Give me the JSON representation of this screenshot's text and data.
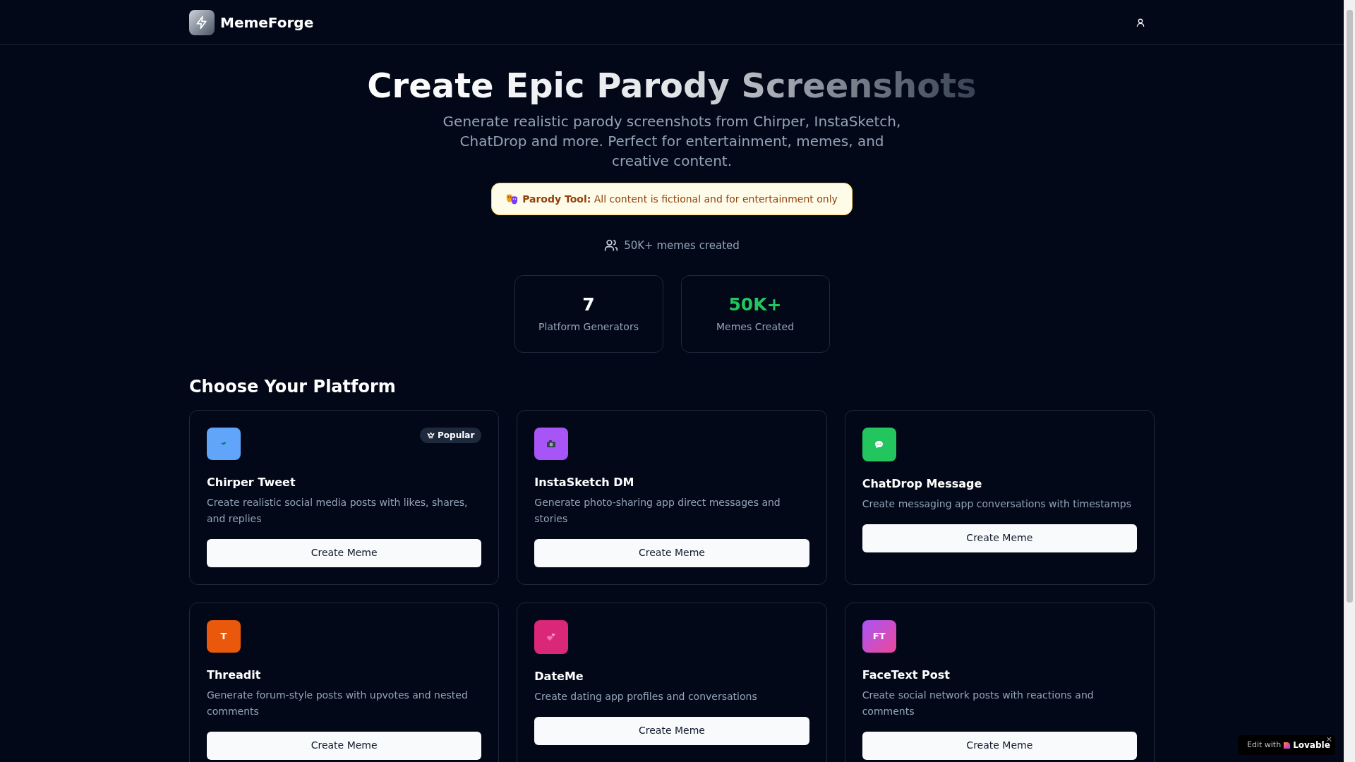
{
  "header": {
    "brand": "MemeForge"
  },
  "hero": {
    "title": "Create Epic Parody Screenshots",
    "subtitle": "Generate realistic parody screenshots from Chirper, InstaSketch, ChatDrop and more. Perfect for entertainment, memes, and creative content.",
    "notice": "**Parody Tool:** All content is fictional and for entertainment only",
    "count": "50K+ memes created"
  },
  "stats": [
    {
      "value": "7",
      "label": "Platform Generators",
      "color": "#ffffff"
    },
    {
      "value": "50K+",
      "label": "Memes Created",
      "color": "#22c55e"
    }
  ],
  "section_title": "Choose Your Platform",
  "platforms": [
    {
      "name": "Chirper Tweet",
      "description": "Create realistic social media posts with likes, shares, and replies",
      "kind": "bird",
      "color": "#60a5fa",
      "badge": "Popular",
      "button": "Create Meme"
    },
    {
      "name": "InstaSketch DM",
      "description": "Generate photo-sharing app direct messages and stories",
      "kind": "camera",
      "color": "#a855f7",
      "button": "Create Meme"
    },
    {
      "name": "ChatDrop Message",
      "description": "Create messaging app conversations with timestamps",
      "kind": "chat",
      "color": "#22c55e",
      "button": "Create Meme"
    },
    {
      "name": "Threadit",
      "description": "Generate forum-style posts with upvotes and nested comments",
      "kind": "letters",
      "letters": "T",
      "color": "#ea580c",
      "button": "Create Meme"
    },
    {
      "name": "DateMe",
      "description": "Create dating app profiles and conversations",
      "kind": "hearts",
      "color": "#db2777",
      "button": "Create Meme"
    },
    {
      "name": "FaceText Post",
      "description": "Create social network posts with reactions and comments",
      "kind": "letters",
      "letters": "FT",
      "color": "#c04be0",
      "button": "Create Meme"
    }
  ],
  "overlay_badge": {
    "prefix": "Edit with",
    "brand": "Lovable",
    "close": "×"
  }
}
